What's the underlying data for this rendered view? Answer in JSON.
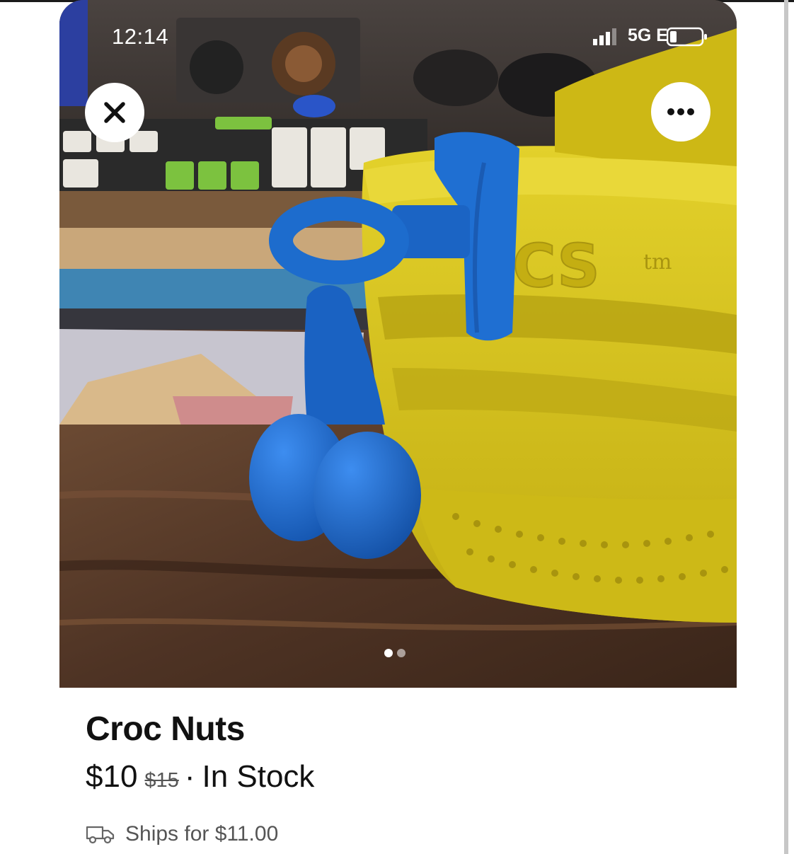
{
  "status_bar": {
    "time": "12:14",
    "network": "5G E",
    "icons": [
      "signal-bars-icon",
      "battery-icon"
    ]
  },
  "photo": {
    "close_icon": "close-icon",
    "more_icon": "more-options-icon",
    "pages": 2,
    "current_page": 1,
    "embossed_text": "CS",
    "embossed_tm": "tm"
  },
  "listing": {
    "title": "Croc Nuts",
    "price": "$10",
    "original_price": "$15",
    "separator": "·",
    "availability": "In Stock",
    "shipping": "Ships for $11.00",
    "shipping_icon": "truck-icon"
  },
  "colors": {
    "croc_yellow": "#d8c51c",
    "charm_blue": "#1d6fd0",
    "text_primary": "#111111",
    "text_secondary": "#555555"
  }
}
